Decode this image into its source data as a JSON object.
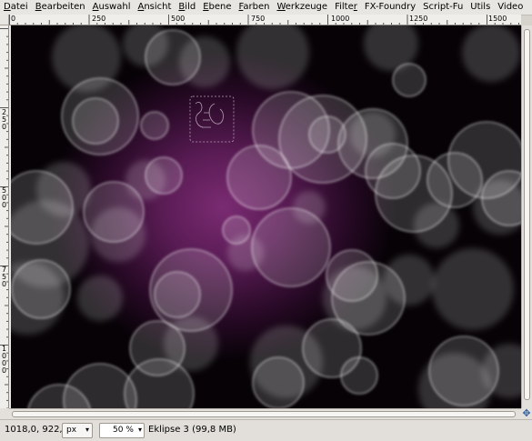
{
  "menu": [
    {
      "pre": "",
      "u": "D",
      "post": "atei"
    },
    {
      "pre": "",
      "u": "B",
      "post": "earbeiten"
    },
    {
      "pre": "",
      "u": "A",
      "post": "uswahl"
    },
    {
      "pre": "",
      "u": "A",
      "post": "nsicht"
    },
    {
      "pre": "",
      "u": "B",
      "post": "ild"
    },
    {
      "pre": "",
      "u": "E",
      "post": "bene"
    },
    {
      "pre": "",
      "u": "F",
      "post": "arben"
    },
    {
      "pre": "",
      "u": "W",
      "post": "erkzeuge"
    },
    {
      "pre": "Filte",
      "u": "r",
      "post": ""
    },
    {
      "pre": "",
      "u": "",
      "post": "FX-Foundry"
    },
    {
      "pre": "",
      "u": "",
      "post": "Script-Fu"
    },
    {
      "pre": "",
      "u": "",
      "post": "Utils"
    },
    {
      "pre": "",
      "u": "",
      "post": "Video"
    }
  ],
  "ruler_h": [
    "0",
    "250",
    "500",
    "750",
    "1000",
    "1250",
    "1500"
  ],
  "ruler_v": [
    "2 5 0",
    "5 0 0",
    "7 5 0",
    "1 0 0 0"
  ],
  "status": {
    "coords": "1018,0, 922,0",
    "unit": "px",
    "zoom": "50 %",
    "layer_info": "Eklipse 3 (99,8 MB)"
  },
  "colors": {
    "canvas_center": "#7a2b72",
    "canvas_edge": "#000000",
    "bokeh": "#ffffff"
  }
}
